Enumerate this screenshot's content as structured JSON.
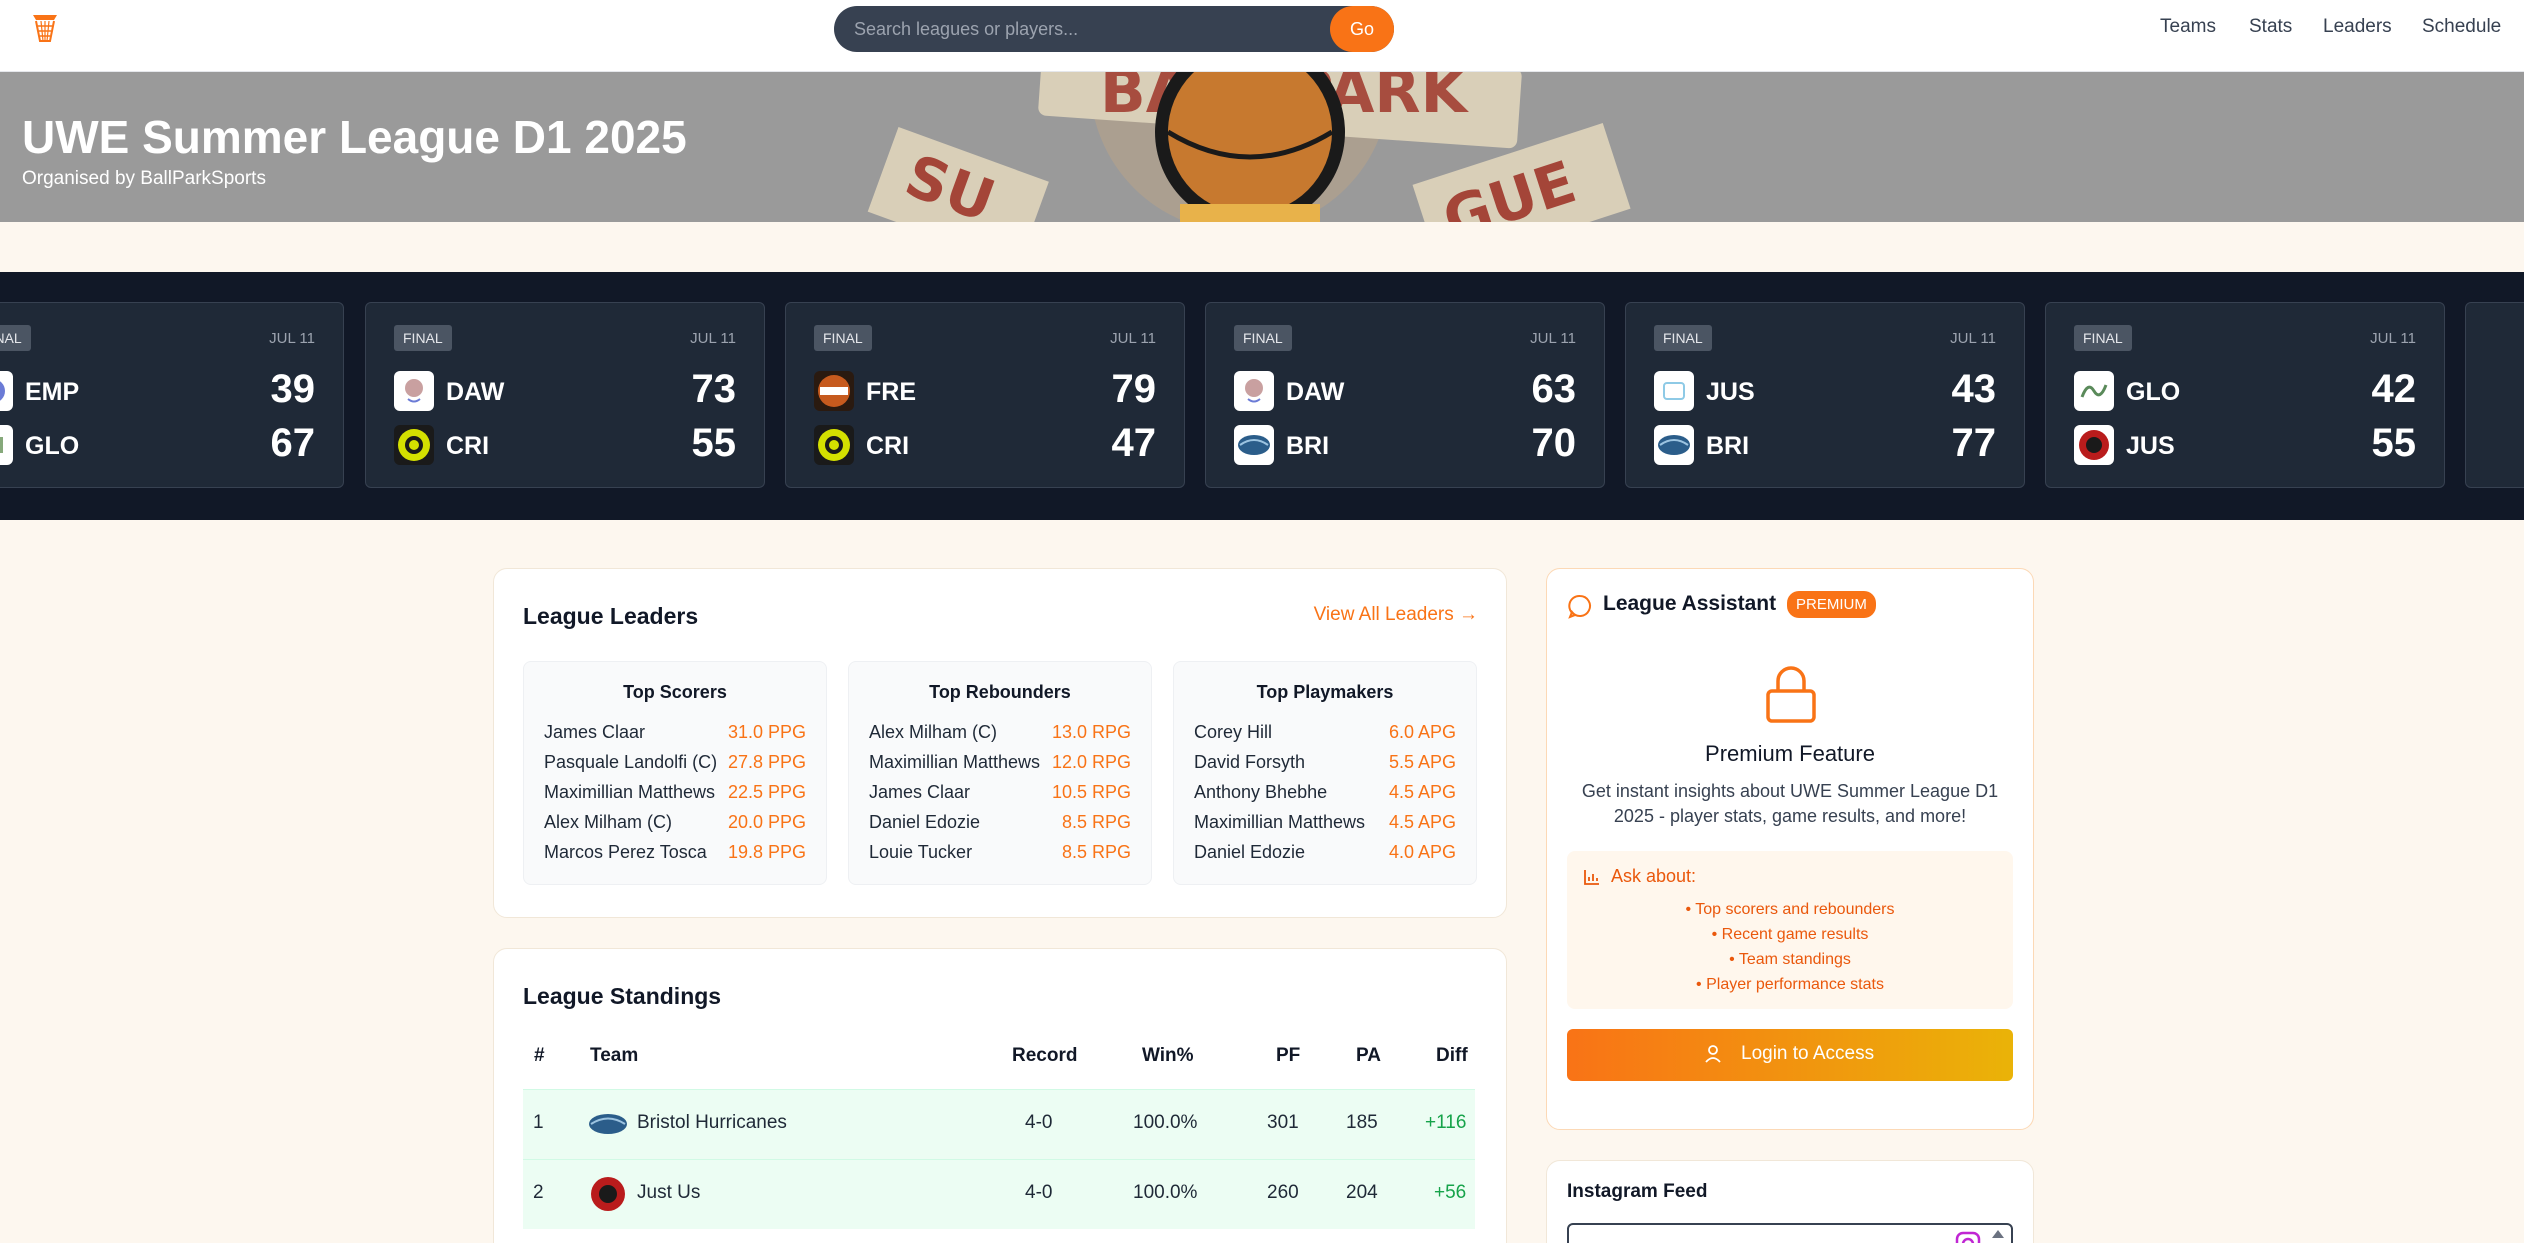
{
  "header": {
    "logo": "basketball-hoop-logo",
    "search_placeholder": "Search leagues or players...",
    "search_button": "Go",
    "nav": [
      "Teams",
      "Stats",
      "Leaders",
      "Schedule"
    ]
  },
  "hero": {
    "title": "UWE Summer League D1 2025",
    "subtitle": "Organised by BallParkSports"
  },
  "games": [
    {
      "status": "FINAL",
      "date": "JUL 11",
      "teams": [
        {
          "abbr": "EMP",
          "score": "39"
        },
        {
          "abbr": "GLO",
          "score": "67"
        }
      ]
    },
    {
      "status": "FINAL",
      "date": "JUL 11",
      "teams": [
        {
          "abbr": "DAW",
          "score": "73"
        },
        {
          "abbr": "CRI",
          "score": "55"
        }
      ]
    },
    {
      "status": "FINAL",
      "date": "JUL 11",
      "teams": [
        {
          "abbr": "FRE",
          "score": "79"
        },
        {
          "abbr": "CRI",
          "score": "47"
        }
      ]
    },
    {
      "status": "FINAL",
      "date": "JUL 11",
      "teams": [
        {
          "abbr": "DAW",
          "score": "63"
        },
        {
          "abbr": "BRI",
          "score": "70"
        }
      ]
    },
    {
      "status": "FINAL",
      "date": "JUL 11",
      "teams": [
        {
          "abbr": "JUS",
          "score": "43"
        },
        {
          "abbr": "BRI",
          "score": "77"
        }
      ]
    },
    {
      "status": "FINAL",
      "date": "JUL 11",
      "teams": [
        {
          "abbr": "GLO",
          "score": "42"
        },
        {
          "abbr": "JUS",
          "score": "55"
        }
      ]
    }
  ],
  "leaders": {
    "title": "League Leaders",
    "view_all": "View All Leaders →",
    "boxes": [
      {
        "title": "Top Scorers",
        "rows": [
          {
            "name": "James Claar",
            "value": "31.0 PPG"
          },
          {
            "name": "Pasquale Landolfi (C)",
            "value": "27.8 PPG"
          },
          {
            "name": "Maximillian Matthews",
            "value": "22.5 PPG"
          },
          {
            "name": "Alex Milham (C)",
            "value": "20.0 PPG"
          },
          {
            "name": "Marcos Perez Tosca",
            "value": "19.8 PPG"
          }
        ]
      },
      {
        "title": "Top Rebounders",
        "rows": [
          {
            "name": "Alex Milham (C)",
            "value": "13.0 RPG"
          },
          {
            "name": "Maximillian Matthews",
            "value": "12.0 RPG"
          },
          {
            "name": "James Claar",
            "value": "10.5 RPG"
          },
          {
            "name": "Daniel Edozie",
            "value": "8.5 RPG"
          },
          {
            "name": "Louie Tucker",
            "value": "8.5 RPG"
          }
        ]
      },
      {
        "title": "Top Playmakers",
        "rows": [
          {
            "name": "Corey Hill",
            "value": "6.0 APG"
          },
          {
            "name": "David Forsyth",
            "value": "5.5 APG"
          },
          {
            "name": "Anthony Bhebhe",
            "value": "4.5 APG"
          },
          {
            "name": "Maximillian Matthews",
            "value": "4.5 APG"
          },
          {
            "name": "Daniel Edozie",
            "value": "4.0 APG"
          }
        ]
      }
    ]
  },
  "standings": {
    "title": "League Standings",
    "columns": [
      "#",
      "Team",
      "Record",
      "Win%",
      "PF",
      "PA",
      "Diff"
    ],
    "rows": [
      {
        "rank": "1",
        "team": "Bristol Hurricanes",
        "record": "4-0",
        "win_pct": "100.0%",
        "pf": "301",
        "pa": "185",
        "diff": "+116"
      },
      {
        "rank": "2",
        "team": "Just Us",
        "record": "4-0",
        "win_pct": "100.0%",
        "pf": "260",
        "pa": "204",
        "diff": "+56"
      }
    ]
  },
  "assistant": {
    "title": "League Assistant",
    "badge": "PREMIUM",
    "feature_title": "Premium Feature",
    "description": "Get instant insights about UWE Summer League D1 2025 - player stats, game results, and more!",
    "ask_title": "Ask about:",
    "ask_items": [
      "• Top scorers and rebounders",
      "• Recent game results",
      "• Team standings",
      "• Player performance stats"
    ],
    "login_button": "Login to Access"
  },
  "instagram": {
    "title": "Instagram Feed"
  },
  "colors": {
    "accent": "#f97316",
    "scores_bg": "#111827",
    "positive": "#16a34a",
    "page_bg": "#fdf7ef"
  }
}
